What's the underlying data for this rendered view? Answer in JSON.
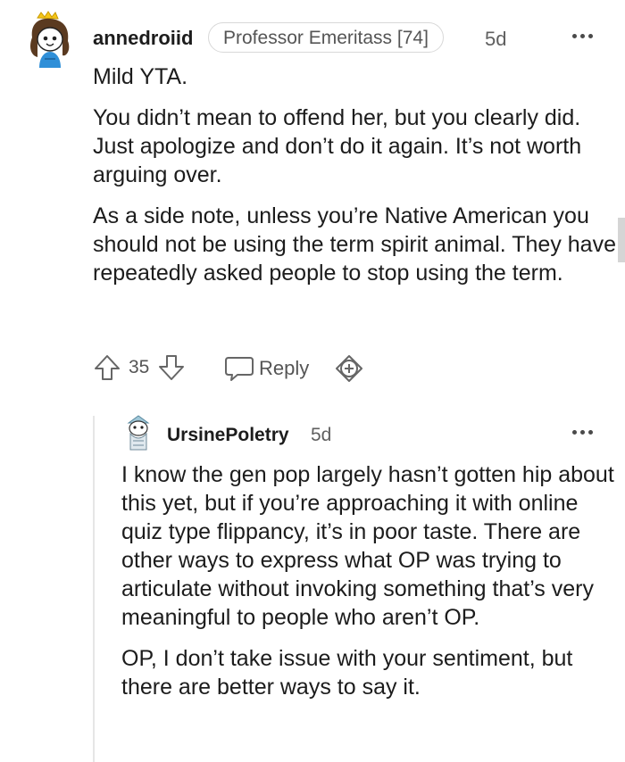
{
  "comment": {
    "username": "annedroiid",
    "flair": "Professor Emeritass [74]",
    "timestamp": "5d",
    "paragraphs": [
      "Mild YTA.",
      "You didn’t mean to offend her, but you clearly did. Just apologize and don’t do it again. It’s not worth arguing over.",
      "As a side note, unless you’re Native American you should not be using the term spirit animal. They have repeatedly asked people to stop using the term."
    ],
    "votes": "35",
    "reply_label": "Reply",
    "icons": {
      "upvote": "arrow-up-icon",
      "downvote": "arrow-down-icon",
      "reply": "chat-bubble-icon",
      "award": "award-plus-icon",
      "more": "more-options-icon"
    }
  },
  "reply": {
    "username": "UrsinePoletry",
    "timestamp": "5d",
    "paragraphs": [
      "I know the gen pop largely hasn’t gotten hip about this yet, but if you’re approaching it with online quiz type flippancy, it’s in poor taste. There are other ways to express what OP was trying to articulate without invoking something that’s very meaningful to people who aren’t OP.",
      "OP, I don’t take issue with your sentiment, but there are better ways to say it."
    ]
  }
}
